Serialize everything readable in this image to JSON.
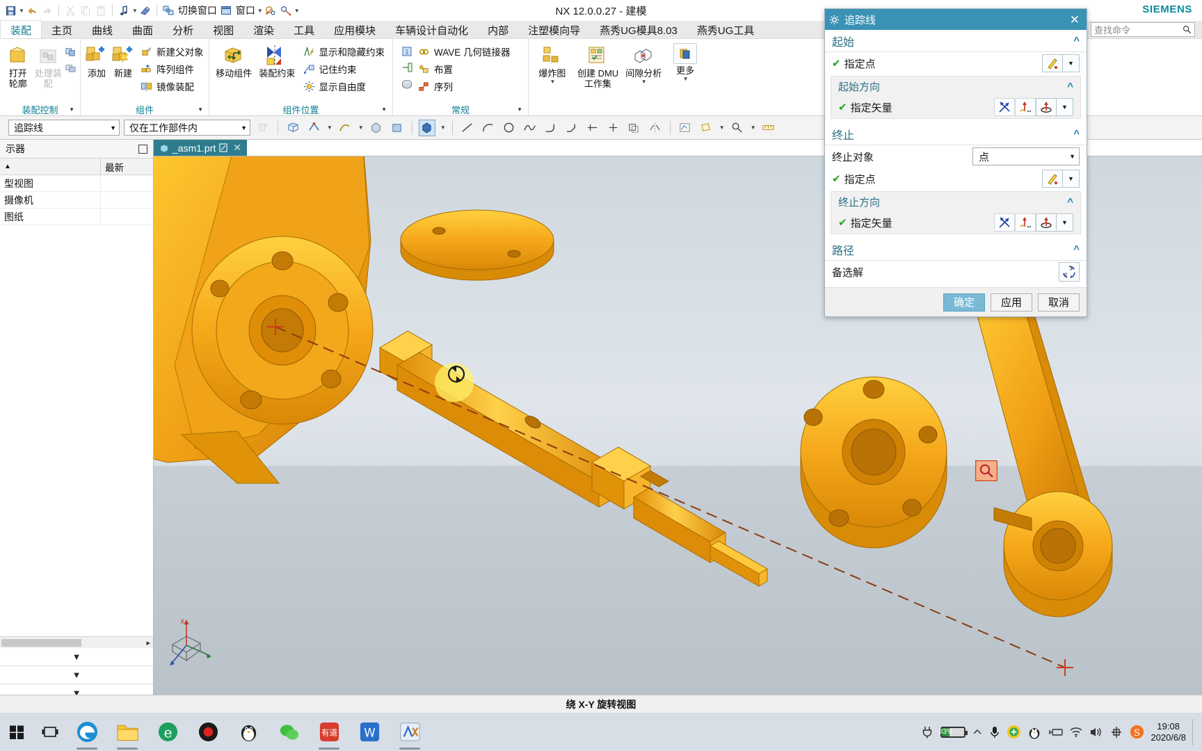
{
  "window": {
    "title": "NX 12.0.0.27 - 建模",
    "brand": "SIEMENS"
  },
  "quick_access": {
    "items": [
      {
        "name": "save-icon",
        "glyph": "💾"
      },
      {
        "name": "undo-icon",
        "glyph": "↶"
      },
      {
        "name": "redo-icon",
        "glyph": "↷"
      },
      {
        "name": "cut-icon",
        "glyph": "✂"
      },
      {
        "name": "copy-icon",
        "glyph": "⧉"
      },
      {
        "name": "paste-icon",
        "glyph": "📋"
      },
      {
        "name": "note-icon",
        "glyph": "♪"
      },
      {
        "name": "eraser-icon",
        "glyph": "▱"
      }
    ],
    "switch_window_label": "切换窗口",
    "window_label": "窗口"
  },
  "search": {
    "placeholder": "查找命令",
    "icon": "search-icon"
  },
  "tabs": [
    {
      "label": "装配",
      "active": true
    },
    {
      "label": "主页",
      "active": false
    },
    {
      "label": "曲线",
      "active": false
    },
    {
      "label": "曲面",
      "active": false
    },
    {
      "label": "分析",
      "active": false
    },
    {
      "label": "视图",
      "active": false
    },
    {
      "label": "渲染",
      "active": false
    },
    {
      "label": "工具",
      "active": false
    },
    {
      "label": "应用模块",
      "active": false
    },
    {
      "label": "车辆设计自动化",
      "active": false
    },
    {
      "label": "内部",
      "active": false
    },
    {
      "label": "注塑模向导",
      "active": false
    },
    {
      "label": "燕秀UG模具8.03",
      "active": false
    },
    {
      "label": "燕秀UG工具",
      "active": false
    }
  ],
  "ribbon": {
    "groups": [
      {
        "label": "装配控制",
        "big": [
          {
            "label": "打开\n轮廓",
            "name": "open-profile-button",
            "dim": false
          },
          {
            "label": "处理装配",
            "name": "process-assembly-button",
            "dim": true
          }
        ],
        "icons": [
          "assembly-icon-1",
          "assembly-icon-2"
        ]
      },
      {
        "label": "组件",
        "big": [
          {
            "label": "添加",
            "name": "add-component-button"
          },
          {
            "label": "新建",
            "name": "new-component-button"
          }
        ],
        "small": [
          {
            "label": "新建父对象",
            "name": "new-parent-button"
          },
          {
            "label": "阵列组件",
            "name": "pattern-component-button"
          },
          {
            "label": "镜像装配",
            "name": "mirror-assembly-button"
          }
        ]
      },
      {
        "label": "组件位置",
        "big": [
          {
            "label": "移动组件",
            "name": "move-component-button"
          },
          {
            "label": "装配约束",
            "name": "assembly-constraint-button"
          }
        ],
        "small": [
          {
            "label": "显示和隐藏约束",
            "name": "show-hide-constraints-button"
          },
          {
            "label": "记住约束",
            "name": "remember-constraints-button"
          },
          {
            "label": "显示自由度",
            "name": "show-dof-button"
          }
        ]
      },
      {
        "label": "常规",
        "small": [
          {
            "label": "WAVE 几何链接器",
            "name": "wave-geometry-linker-button"
          },
          {
            "label": "布置",
            "name": "arrangement-button"
          },
          {
            "label": "序列",
            "name": "sequence-button"
          }
        ]
      },
      {
        "label": "",
        "big": [
          {
            "label": "爆炸图",
            "name": "exploded-view-button",
            "hasCaret": true
          },
          {
            "label": "创建 DMU\n工作集",
            "name": "create-dmu-workset-button"
          },
          {
            "label": "间隙分析",
            "name": "clearance-analysis-button",
            "hasCaret": true
          },
          {
            "label": "更多",
            "name": "more-button",
            "hasCaret": true
          }
        ]
      }
    ]
  },
  "toolbar2": {
    "mode_select": "追踪线",
    "scope_select": "仅在工作部件内"
  },
  "left_panel": {
    "title": "示器",
    "columns": [
      "",
      "最新"
    ],
    "rows": [
      {
        "name": "型视图",
        "latest": ""
      },
      {
        "name": "摄像机",
        "latest": ""
      },
      {
        "name": "图纸",
        "latest": ""
      }
    ]
  },
  "document_tab": {
    "label": "_asm1.prt",
    "modified_icon": "modified-icon",
    "close_icon": "close-icon"
  },
  "status": {
    "left": "",
    "message": "绕 X-Y 旋转视图",
    "bottom_message": "绕 X-Y 旋转视图"
  },
  "dialog": {
    "title": "追踪线",
    "close_icon": "close-icon",
    "sections": [
      {
        "id": "start",
        "title": "起始",
        "rows": [
          {
            "type": "check-row",
            "label": "指定点",
            "checked": true,
            "buttons": [
              "point-constructor-icon",
              "dropdown-arrow"
            ]
          }
        ],
        "subgroup": {
          "title": "起始方向",
          "rows": [
            {
              "type": "check-row",
              "label": "指定矢量",
              "checked": true,
              "buttons": [
                "inferred-vector-icon",
                "vector-dialog-icon",
                "vector-constructor-icon",
                "dropdown-arrow"
              ]
            }
          ]
        }
      },
      {
        "id": "end",
        "title": "终止",
        "rows": [
          {
            "type": "select-row",
            "label": "终止对象",
            "value": "点"
          },
          {
            "type": "check-row",
            "label": "指定点",
            "checked": true,
            "buttons": [
              "point-constructor-icon",
              "dropdown-arrow"
            ]
          }
        ],
        "subgroup": {
          "title": "终止方向",
          "rows": [
            {
              "type": "check-row",
              "label": "指定矢量",
              "checked": true,
              "buttons": [
                "inferred-vector-icon",
                "vector-dialog-icon",
                "vector-constructor-icon",
                "dropdown-arrow"
              ]
            }
          ]
        }
      },
      {
        "id": "path",
        "title": "路径",
        "rows": [
          {
            "type": "action-row",
            "label": "备选解",
            "buttons": [
              "alternate-solution-icon"
            ]
          }
        ]
      }
    ],
    "footer": {
      "ok": "确定",
      "apply": "应用",
      "cancel": "取消"
    }
  },
  "taskbar": {
    "apps": [
      {
        "name": "start-button",
        "glyph": "⊞"
      },
      {
        "name": "task-view-button",
        "glyph": "☰"
      },
      {
        "name": "edge-browser-icon",
        "glyph": "e"
      },
      {
        "name": "file-explorer-icon",
        "glyph": "📁"
      },
      {
        "name": "ie-browser-icon",
        "glyph": "e"
      },
      {
        "name": "media-player-icon",
        "glyph": "◉"
      },
      {
        "name": "qq-icon",
        "glyph": "🐧"
      },
      {
        "name": "wechat-icon",
        "glyph": "💬"
      },
      {
        "name": "youdao-icon",
        "glyph": "有道"
      },
      {
        "name": "wps-icon",
        "glyph": "W"
      },
      {
        "name": "nx-icon",
        "glyph": "🔧"
      }
    ],
    "tray": {
      "battery_percent": "33%",
      "icons": [
        "power-plug-icon",
        "chevron-up-icon",
        "microphone-icon",
        "360-security-icon",
        "qq-penguin-icon",
        "usb-device-icon",
        "wifi-icon",
        "volume-icon",
        "ime-chinese-icon",
        "sogou-input-icon"
      ],
      "time": "19:08",
      "date": "2020/6/8"
    }
  },
  "colors": {
    "accent": "#3a92b5",
    "tab_active_text": "#0b7f94",
    "siemens": "#0a8a9c",
    "doc_tab_bg": "#2e7d8f",
    "check_green": "#22a022",
    "model_gold": "#f0a81e"
  }
}
